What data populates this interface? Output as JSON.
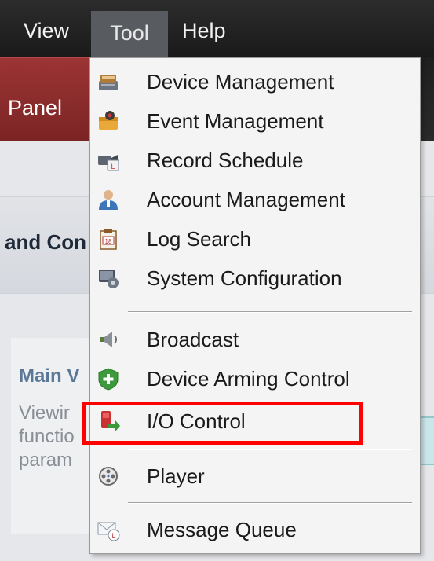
{
  "menubar": {
    "items": [
      {
        "label": "View"
      },
      {
        "label": "Tool"
      },
      {
        "label": "Help"
      }
    ],
    "active": "Tool"
  },
  "background": {
    "panel_tab": "Panel",
    "section_header": "and Con",
    "card_title": "Main V",
    "card_lines": [
      "Viewir",
      "functio",
      "param"
    ]
  },
  "dropdown": {
    "items": [
      {
        "label": "Device Management",
        "icon": "device-management-icon"
      },
      {
        "label": "Event Management",
        "icon": "event-management-icon"
      },
      {
        "label": "Record Schedule",
        "icon": "record-schedule-icon"
      },
      {
        "label": "Account Management",
        "icon": "account-management-icon"
      },
      {
        "label": "Log Search",
        "icon": "log-search-icon"
      },
      {
        "label": "System Configuration",
        "icon": "system-configuration-icon"
      },
      {
        "label": "Broadcast",
        "icon": "broadcast-icon"
      },
      {
        "label": "Device Arming Control",
        "icon": "device-arming-control-icon"
      },
      {
        "label": "I/O Control",
        "icon": "io-control-icon"
      },
      {
        "label": "Player",
        "icon": "player-icon"
      },
      {
        "label": "Message Queue",
        "icon": "message-queue-icon"
      }
    ],
    "highlighted": "I/O Control"
  },
  "colors": {
    "highlight_border": "#ff0000",
    "menubar_bg": "#1f1f1f",
    "active_menu_bg": "#585b60",
    "panel_tab_bg": "#8c2c2c",
    "tooltip_bg": "#c9e6ea"
  }
}
